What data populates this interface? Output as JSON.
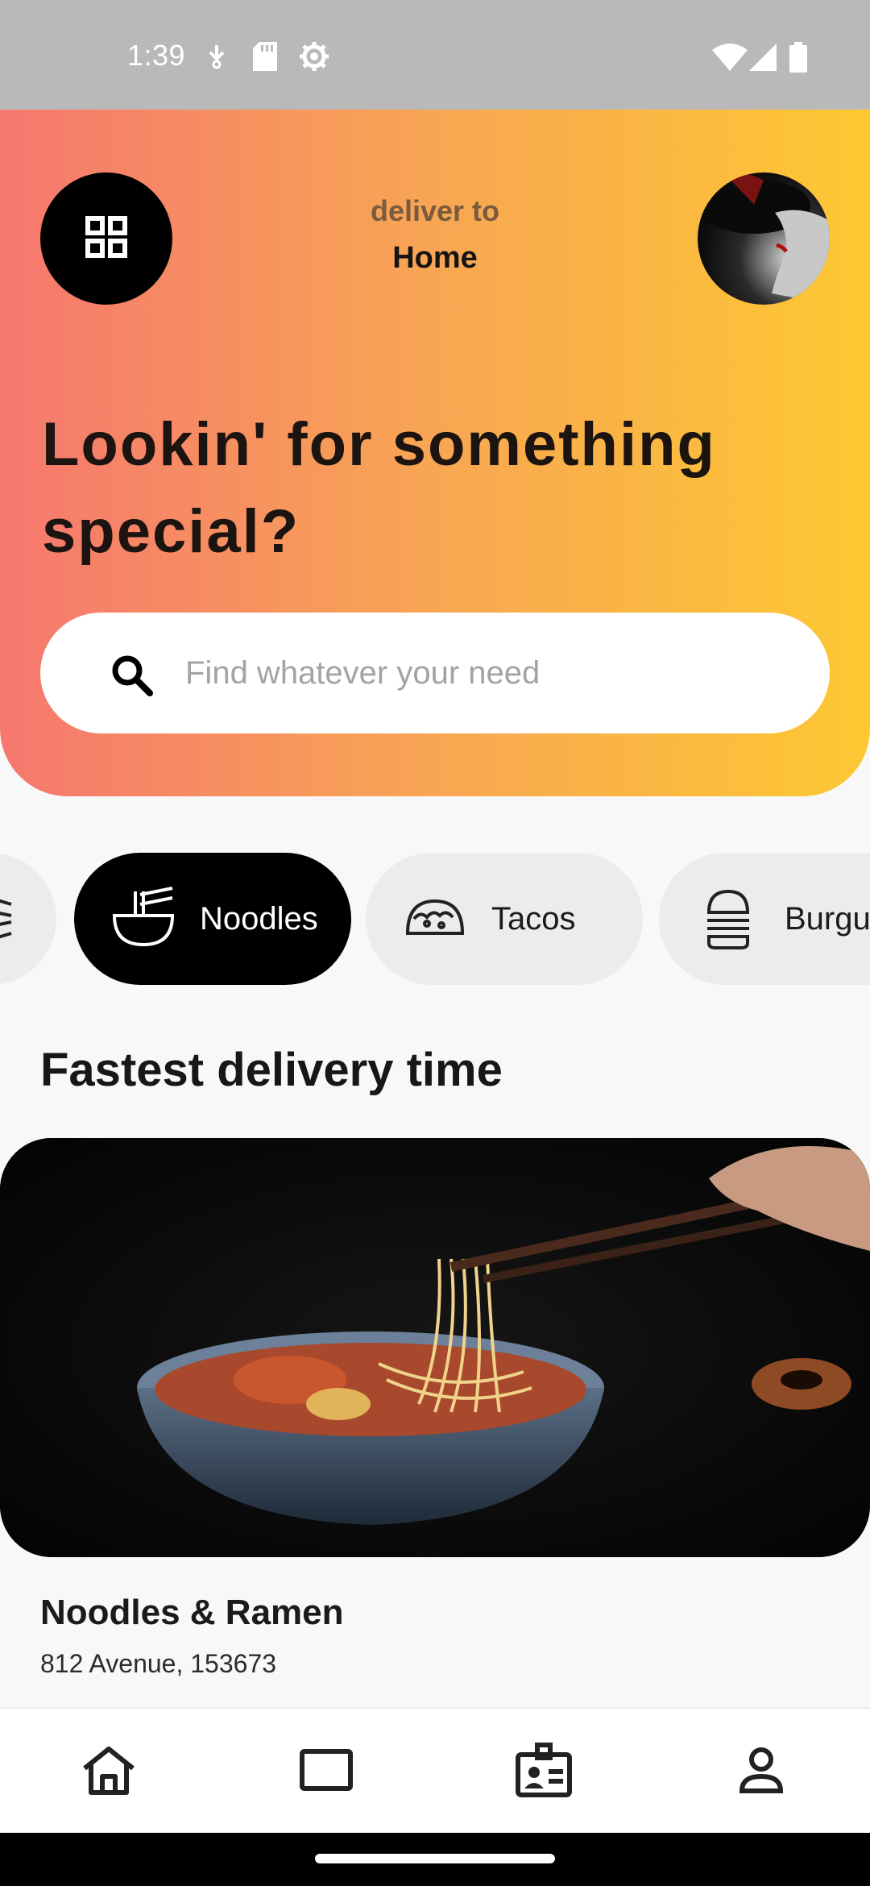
{
  "status_bar": {
    "time": "1:39",
    "icons": [
      "download-icon",
      "sd-card-icon",
      "settings-gear-icon",
      "wifi-icon",
      "cell-signal-icon",
      "battery-icon"
    ]
  },
  "header": {
    "menu_icon": "grid-menu-icon",
    "deliver_label": "deliver to",
    "deliver_value": "Home",
    "headline": "Lookin' for something special?"
  },
  "search": {
    "placeholder": "Find whatever your need"
  },
  "categories": [
    {
      "label": "",
      "icon": "list-icon",
      "active": false
    },
    {
      "label": "Noodles",
      "icon": "noodle-bowl-icon",
      "active": true
    },
    {
      "label": "Tacos",
      "icon": "taco-icon",
      "active": false
    },
    {
      "label": "Burgue",
      "icon": "burger-icon",
      "active": false
    }
  ],
  "section": {
    "title": "Fastest delivery time"
  },
  "restaurant": {
    "name": "Noodles & Ramen",
    "address": "812 Avenue, 153673"
  },
  "bottom_nav": [
    {
      "icon": "home-icon"
    },
    {
      "icon": "tablet-icon"
    },
    {
      "icon": "id-badge-icon"
    },
    {
      "icon": "profile-icon"
    }
  ],
  "colors": {
    "gradient_start": "#f6776f",
    "gradient_mid": "#f8a653",
    "gradient_end": "#fdc832",
    "active_chip": "#000000",
    "inactive_chip": "#ececec"
  }
}
